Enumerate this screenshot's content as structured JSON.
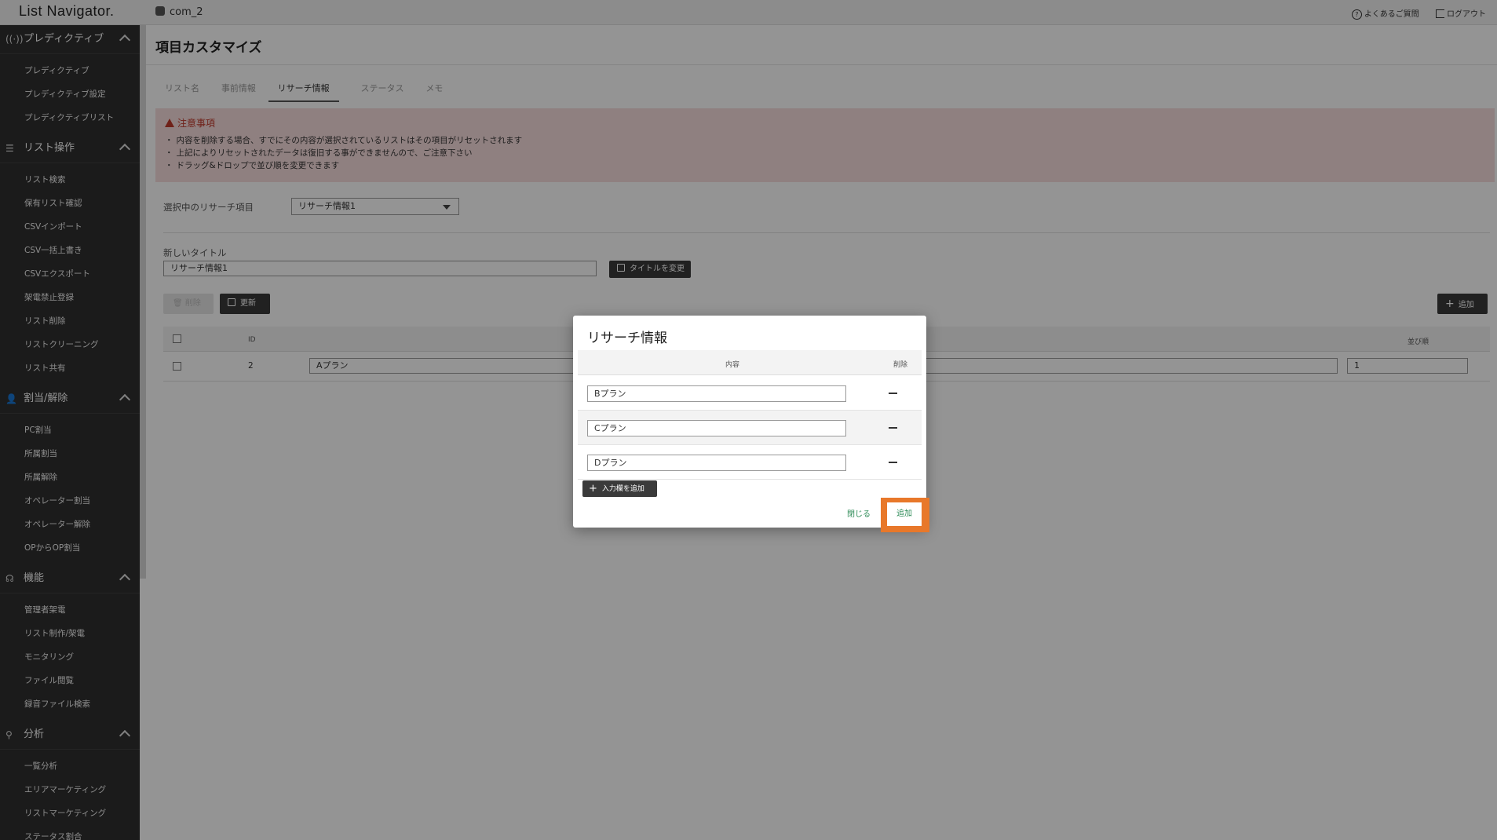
{
  "topbar": {
    "logo": "List Navigator.",
    "company": "com_2",
    "faq": "よくあるご質問",
    "logout": "ログアウト"
  },
  "sidebar": {
    "sections": [
      {
        "title": "プレディクティブ",
        "icon": "signal-icon",
        "items": [
          "プレディクティブ",
          "プレディクティブ設定",
          "プレディクティブリスト"
        ]
      },
      {
        "title": "リスト操作",
        "icon": "list-icon",
        "items": [
          "リスト検索",
          "保有リスト確認",
          "CSVインポート",
          "CSV一括上書き",
          "CSVエクスポート",
          "架電禁止登録",
          "リスト削除",
          "リストクリーニング",
          "リスト共有"
        ]
      },
      {
        "title": "割当/解除",
        "icon": "user-check-icon",
        "items": [
          "PC割当",
          "所属割当",
          "所属解除",
          "オペレーター割当",
          "オペレーター解除",
          "OPからOP割当"
        ]
      },
      {
        "title": "機能",
        "icon": "headset-icon",
        "items": [
          "管理者架電",
          "リスト制作/架電",
          "モニタリング",
          "ファイル閲覧",
          "録音ファイル検索"
        ]
      },
      {
        "title": "分析",
        "icon": "search-icon",
        "items": [
          "一覧分析",
          "エリアマーケティング",
          "リストマーケティング",
          "ステータス割合"
        ]
      }
    ]
  },
  "main": {
    "title": "項目カスタマイズ",
    "tabs": [
      "リスト名",
      "事前情報",
      "リサーチ情報",
      "ステータス",
      "メモ"
    ],
    "active_tab": "リサーチ情報",
    "notice": {
      "title": "注意事項",
      "items": [
        "内容を削除する場合、すでにその内容が選択されているリストはその項目がリセットされます",
        "上記によりリセットされたデータは復旧する事ができませんので、ご注意下さい",
        "ドラッグ&ドロップで並び順を変更できます"
      ]
    },
    "select_label": "選択中のリサーチ項目",
    "select_value": "リサーチ情報1",
    "new_title_label": "新しいタイトル",
    "new_title_value": "リサーチ情報1",
    "change_title_button": "タイトルを変更",
    "delete_button": "削除",
    "update_button": "更新",
    "add_button": "追加",
    "table": {
      "headers": {
        "id": "ID",
        "order": "並び順"
      },
      "rows": [
        {
          "id": "2",
          "content": "Aプラン",
          "order": "1"
        }
      ]
    }
  },
  "modal": {
    "title": "リサーチ情報",
    "col_content": "内容",
    "col_delete": "削除",
    "rows": [
      "Bプラン",
      "Cプラン",
      "Dプラン"
    ],
    "add_field_button": "入力欄を追加",
    "close_button": "閉じる",
    "add_button": "追加",
    "highlight_color": "#e8782a"
  }
}
